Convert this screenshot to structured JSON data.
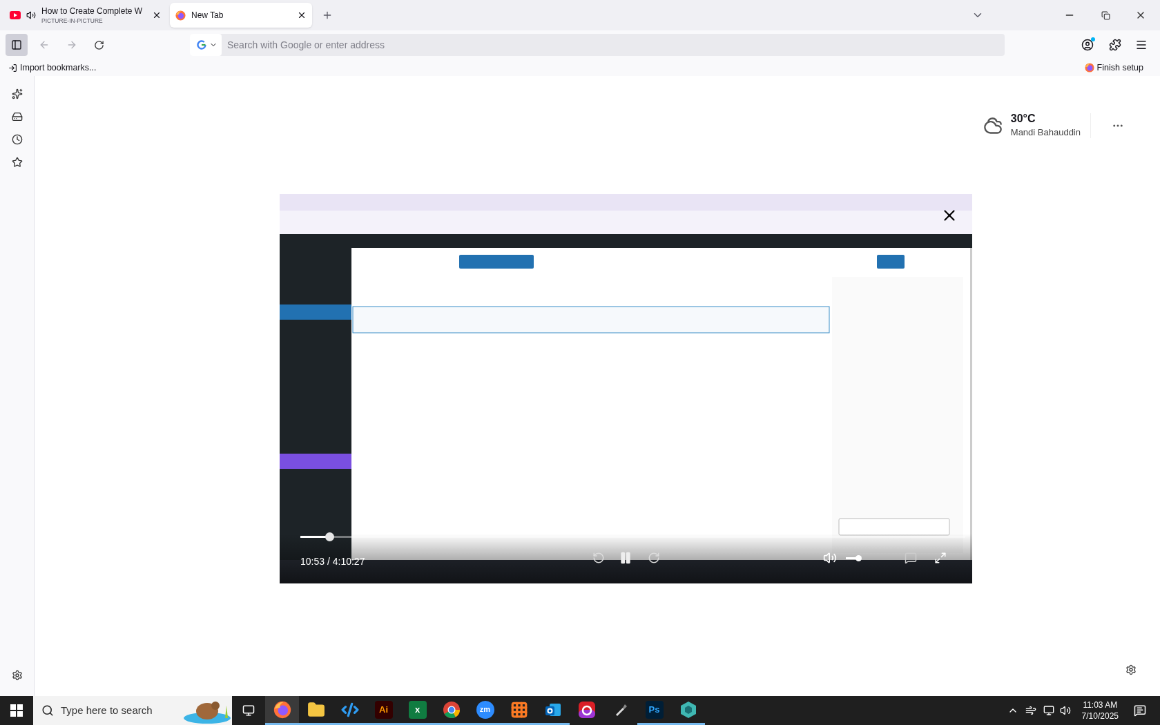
{
  "tabs": [
    {
      "title": "How to Create Complete W",
      "subtitle": "PICTURE-IN-PICTURE",
      "selected": false,
      "audio": true
    },
    {
      "title": "New Tab",
      "selected": true
    }
  ],
  "address_bar": {
    "placeholder": "Search with Google or enter address"
  },
  "bookmarks_bar": {
    "import": "Import bookmarks...",
    "finish_setup": "Finish setup"
  },
  "weather": {
    "temperature": "30°C",
    "location": "Mandi Bahauddin"
  },
  "pip": {
    "time": "10:53 / 4:10:27",
    "playing": true
  },
  "taskbar": {
    "search_placeholder": "Type here to search",
    "apps": [
      {
        "kind": "firefox",
        "running": true,
        "active": true
      },
      {
        "kind": "explorer",
        "running": true,
        "active": false
      },
      {
        "kind": "vscode",
        "running": true,
        "active": false
      },
      {
        "kind": "illustrator",
        "label": "Ai",
        "running": true,
        "active": false
      },
      {
        "kind": "excel",
        "label": "x",
        "running": true,
        "active": false
      },
      {
        "kind": "chrome",
        "running": true,
        "active": false
      },
      {
        "kind": "zoom",
        "label": "zm",
        "running": true,
        "active": false
      },
      {
        "kind": "xampp",
        "running": true,
        "active": false
      },
      {
        "kind": "outlook",
        "running": true,
        "active": false
      },
      {
        "kind": "creative-cloud",
        "running": false,
        "active": false
      },
      {
        "kind": "pen",
        "running": false,
        "active": false
      },
      {
        "kind": "photoshop",
        "label": "Ps",
        "running": true,
        "active": false
      },
      {
        "kind": "gem",
        "running": true,
        "active": false
      }
    ],
    "clock": {
      "time": "11:03 AM",
      "date": "7/10/2025"
    }
  }
}
